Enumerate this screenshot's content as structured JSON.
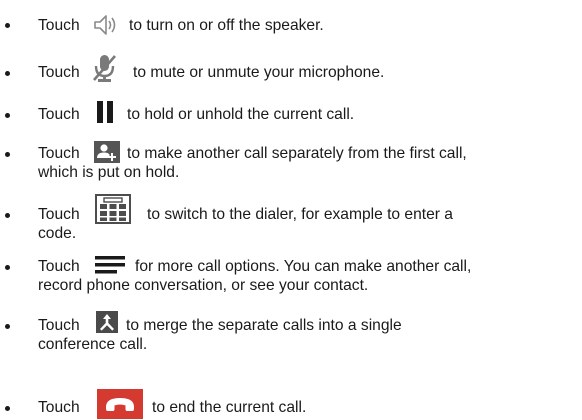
{
  "instructions": [
    {
      "lead": "Touch",
      "icon": "speaker-icon",
      "line1": "to turn on or off the speaker.",
      "line2": ""
    },
    {
      "lead": "Touch",
      "icon": "microphone-mute-icon",
      "line1": "to mute or unmute your microphone.",
      "line2": ""
    },
    {
      "lead": "Touch",
      "icon": "pause-icon",
      "line1": "to hold or unhold the current call.",
      "line2": ""
    },
    {
      "lead": "Touch",
      "icon": "add-call-icon",
      "line1": "to make another call separately from the first call,",
      "line2": "which is put on hold."
    },
    {
      "lead": "Touch",
      "icon": "dialpad-icon",
      "line1": "to switch to the dialer, for example to enter a",
      "line2": "code."
    },
    {
      "lead": "Touch",
      "icon": "menu-icon",
      "line1": "for more call options. You can make another call,",
      "line2": "record phone conversation, or see your contact."
    },
    {
      "lead": "Touch",
      "icon": "merge-calls-icon",
      "line1": "to merge the separate calls into a single",
      "line2": "conference call."
    },
    {
      "lead": "Touch",
      "icon": "end-call-icon",
      "line1": "to end the current call.",
      "line2": ""
    }
  ]
}
